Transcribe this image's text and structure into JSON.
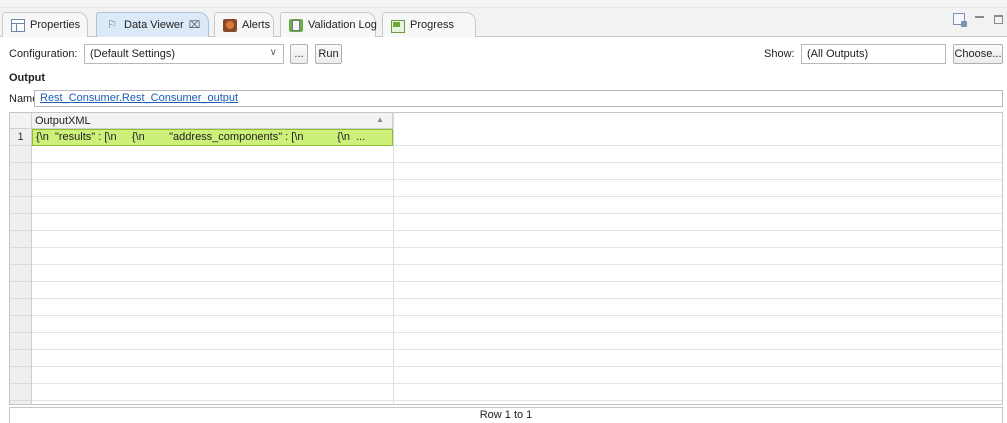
{
  "tabs": [
    {
      "label": "Properties",
      "icon": "properties-icon",
      "active": false
    },
    {
      "label": "Data Viewer",
      "icon": "data-viewer-icon",
      "active": true,
      "close": "⌧"
    },
    {
      "label": "Alerts",
      "icon": "alerts-icon",
      "active": false
    },
    {
      "label": "Validation Log",
      "icon": "validation-log-icon",
      "active": false
    },
    {
      "label": "Progress",
      "icon": "progress-icon",
      "active": false
    }
  ],
  "toolbar": {
    "configuration_label": "Configuration:",
    "configuration_value": "(Default Settings)",
    "ellipsis_label": "...",
    "run_label": "Run",
    "show_label": "Show:",
    "show_value": "(All Outputs)",
    "choose_label": "Choose..."
  },
  "output": {
    "title": "Output",
    "name_label": "Name:",
    "name_value": "Rest_Consumer.Rest_Consumer_output"
  },
  "grid": {
    "columns": [
      "OutputXML"
    ],
    "rows": [
      {
        "num": "1",
        "value": "{\\n  \"results\" : [\\n     {\\n        \"address_components\" : [\\n           {\\n  ..."
      }
    ]
  },
  "status": {
    "text": "Row 1 to 1"
  },
  "colors": {
    "active_tab": "#dce9f7",
    "selected_cell": "#ccf07a",
    "link": "#1b5db5"
  }
}
